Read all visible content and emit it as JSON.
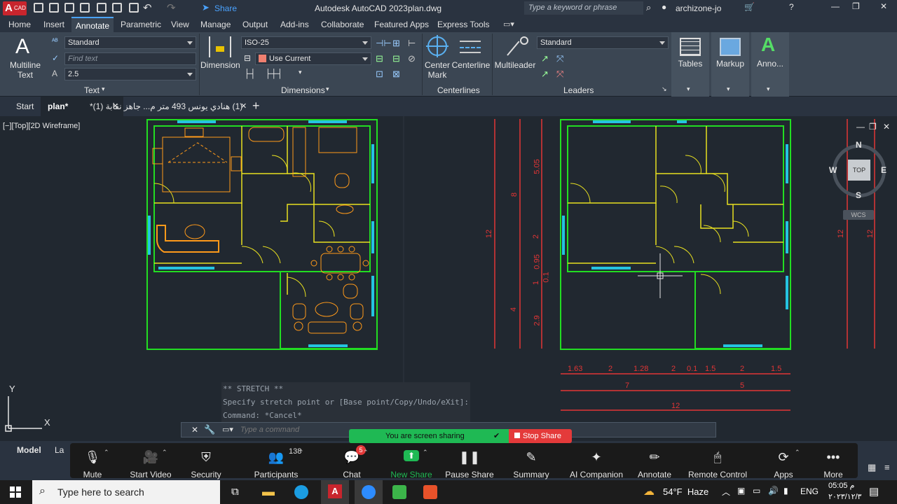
{
  "title_bar": {
    "app_badge": "CAD",
    "app_letter": "A",
    "share_label": "Share",
    "title": "Autodesk AutoCAD 2023",
    "filename": "plan.dwg",
    "search_placeholder": "Type a keyword or phrase",
    "user": "archizone-jo"
  },
  "ribbon_tabs": [
    "Home",
    "Insert",
    "Annotate",
    "Parametric",
    "View",
    "Manage",
    "Output",
    "Add-ins",
    "Collaborate",
    "Featured Apps",
    "Express Tools"
  ],
  "ribbon": {
    "text_panel": {
      "multiline_label_1": "Multiline",
      "multiline_label_2": "Text",
      "style_value": "Standard",
      "find_placeholder": "Find text",
      "height_value": "2.5",
      "panel_title": "Text"
    },
    "dimensions_panel": {
      "dimension_label": "Dimension",
      "dimstyle_value": "ISO-25",
      "layer_value": "Use Current",
      "panel_title": "Dimensions"
    },
    "centerlines_panel": {
      "center_mark_1": "Center",
      "center_mark_2": "Mark",
      "centerline_label": "Centerline",
      "panel_title": "Centerlines"
    },
    "leaders_panel": {
      "multileader_label": "Multileader",
      "style_value": "Standard",
      "panel_title": "Leaders"
    },
    "tables_label": "Tables",
    "markup_label": "Markup",
    "annotation_label": "Anno..."
  },
  "file_tabs": {
    "start": "Start",
    "plan": "plan*",
    "other": "(1) هنادي يونس 493 متر م... جاهز نقابة (1)*",
    "add": "+"
  },
  "viewport": {
    "label": "[−][Top][2D Wireframe]",
    "viewcube_top": "TOP",
    "compass_n": "N",
    "compass_s": "S",
    "compass_e": "E",
    "compass_w": "W",
    "wcs": "WCS",
    "ucs_y": "Y",
    "ucs_x": "X"
  },
  "dimensions": {
    "vertical_left": [
      "5.05",
      "2",
      "0.95",
      "0.1",
      "1",
      "4",
      "2.9"
    ],
    "vertical_outer_left": [
      "8",
      "12"
    ],
    "vertical_right": [
      "12",
      "12"
    ],
    "row1": [
      "1.63",
      "2",
      "1.28",
      "2",
      "0.1",
      "1.5",
      "2",
      "1.5"
    ],
    "row2": [
      "7",
      "5"
    ],
    "row3": [
      "12"
    ]
  },
  "command": {
    "history": [
      "** STRETCH **",
      "Specify stretch point or [Base point/Copy/Undo/eXit]:",
      "Command: *Cancel*"
    ],
    "placeholder": "Type a command"
  },
  "layout_tabs": {
    "model": "Model",
    "layout": "La"
  },
  "zoom": {
    "sharing_text": "You are screen sharing",
    "stop_share": "Stop Share",
    "items": [
      {
        "label": "Mute",
        "icon": "microphone-icon"
      },
      {
        "label": "Start Video",
        "icon": "video-off-icon"
      },
      {
        "label": "Security",
        "icon": "shield-icon"
      },
      {
        "label": "Participants",
        "icon": "participants-icon",
        "count": "138"
      },
      {
        "label": "Chat",
        "icon": "chat-icon",
        "badge": "5"
      },
      {
        "label": "New Share",
        "icon": "share-arrow-icon"
      },
      {
        "label": "Pause Share",
        "icon": "pause-icon"
      },
      {
        "label": "Summary",
        "icon": "summary-icon"
      },
      {
        "label": "AI Companion",
        "icon": "sparkle-icon"
      },
      {
        "label": "Annotate",
        "icon": "pen-icon"
      },
      {
        "label": "Remote Control",
        "icon": "mouse-icon"
      },
      {
        "label": "Apps",
        "icon": "apps-icon"
      },
      {
        "label": "More",
        "icon": "more-icon"
      }
    ]
  },
  "taskbar": {
    "search_placeholder": "Type here to search",
    "weather": "54°F  Haze",
    "lang": "ENG",
    "time": "05:05 م",
    "date": "٢٠٢٣/١٢/٣"
  },
  "colors": {
    "accent": "#4aa3ff",
    "plan_wall": "#22dd22",
    "plan_yellow": "#e8e020",
    "furniture": "#ff9a1a",
    "window": "#25c4e0",
    "dimension": "#e23535",
    "zoom_green": "#1fb954",
    "zoom_red": "#e43a3a"
  }
}
